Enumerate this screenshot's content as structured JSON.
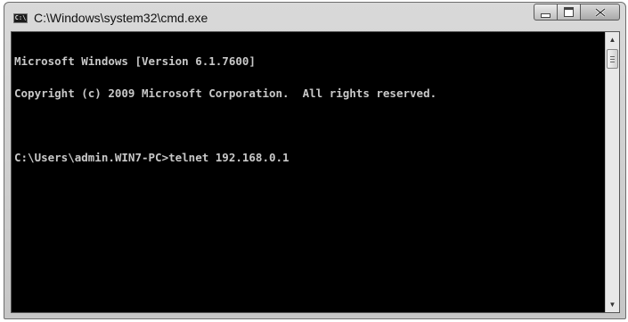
{
  "window": {
    "title": "C:\\Windows\\system32\\cmd.exe",
    "icon_text": "C:\\"
  },
  "controls": {
    "minimize_icon": "minimize-icon",
    "maximize_icon": "maximize-icon",
    "close_icon": "close-icon"
  },
  "console": {
    "lines": [
      "Microsoft Windows [Version 6.1.7600]",
      "Copyright (c) 2009 Microsoft Corporation.  All rights reserved.",
      "",
      "C:\\Users\\admin.WIN7-PC>telnet 192.168.0.1"
    ],
    "colors": {
      "background": "#000000",
      "text": "#c8c8c8"
    }
  },
  "scrollbar": {
    "up_arrow": "▲",
    "down_arrow": "▼"
  }
}
